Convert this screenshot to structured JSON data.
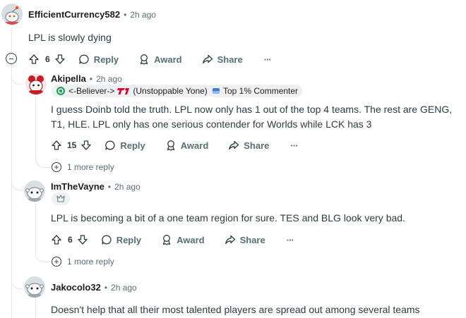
{
  "comments": [
    {
      "author": "EfficientCurrency582",
      "time": "2h ago",
      "body": "LPL is slowly dying",
      "score": "6"
    },
    {
      "author": "Akipella",
      "time": "2h ago",
      "flair_text": "<-Believer->",
      "flair_text2": "(Unstoppable Yone)",
      "achievement": "Top 1% Commenter",
      "body": "I guess Doinb told the truth. LPL now only has 1 out of the top 4 teams. The rest are GENG, T1, HLE. LPL only has one serious contender for Worlds while LCK has 3",
      "score": "15",
      "more_replies": "1 more reply"
    },
    {
      "author": "ImTheVayne",
      "time": "2h ago",
      "body": "LPL is becoming a bit of a one team region for sure. TES and BLG look very bad.",
      "score": "6",
      "more_replies": "1 more reply"
    },
    {
      "author": "Jakocolo32",
      "time": "2h ago",
      "body": "Doesn't help that all their most talented players are spread out among several teams"
    }
  ],
  "labels": {
    "reply": "Reply",
    "award": "Award",
    "share": "Share",
    "dot": "•",
    "collapse": "−",
    "plus": "+",
    "ellipsis": "···"
  },
  "colors": {
    "thread_line": "#e3e7ea",
    "meta": "#576f76",
    "text": "#2a3c42"
  }
}
